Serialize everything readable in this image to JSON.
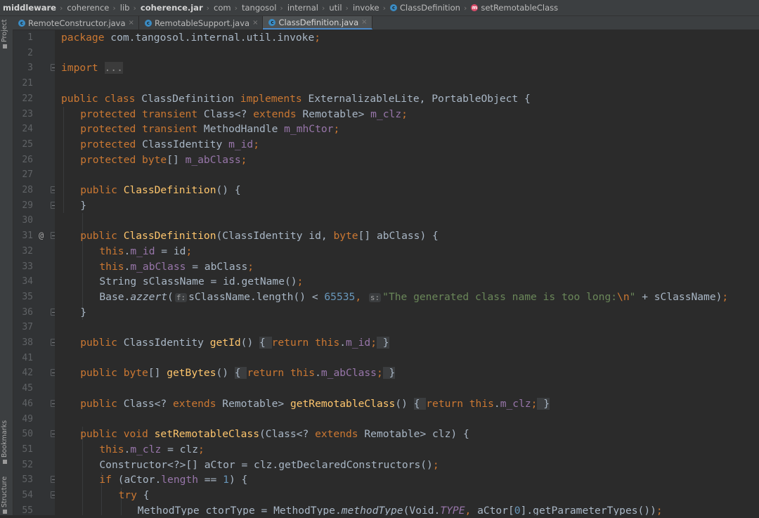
{
  "breadcrumbs": [
    {
      "label": "middleware",
      "bold": true,
      "icon": "none"
    },
    {
      "label": "coherence",
      "bold": false,
      "icon": "none"
    },
    {
      "label": "lib",
      "bold": false,
      "icon": "none"
    },
    {
      "label": "coherence.jar",
      "bold": true,
      "icon": "none"
    },
    {
      "label": "com",
      "bold": false,
      "icon": "none"
    },
    {
      "label": "tangosol",
      "bold": false,
      "icon": "none"
    },
    {
      "label": "internal",
      "bold": false,
      "icon": "none"
    },
    {
      "label": "util",
      "bold": false,
      "icon": "none"
    },
    {
      "label": "invoke",
      "bold": false,
      "icon": "none"
    },
    {
      "label": "ClassDefinition",
      "bold": false,
      "icon": "class-icon"
    },
    {
      "label": "setRemotableClass",
      "bold": false,
      "icon": "method-icon"
    }
  ],
  "tabs": [
    {
      "label": "RemoteConstructor.java",
      "active": false,
      "close": "×"
    },
    {
      "label": "RemotableSupport.java",
      "active": false,
      "close": "×"
    },
    {
      "label": "ClassDefinition.java",
      "active": true,
      "close": "×"
    }
  ],
  "sidebar": {
    "project_label": "Project",
    "bookmarks_label": "Bookmarks",
    "structure_label": "Structure"
  },
  "icon_glyphs": {
    "class-icon": "c",
    "method-icon": "m"
  },
  "colors": {
    "background": "#2b2b2b",
    "keyword": "#cc7832",
    "method": "#ffc66d",
    "field": "#9876aa",
    "string": "#6a8759",
    "number": "#6897bb",
    "text": "#a9b7c6"
  },
  "code": [
    {
      "n": "1",
      "fold": false,
      "mark": "",
      "indent": 0,
      "tokens": [
        [
          "kw",
          "package"
        ],
        [
          "t",
          " com.tangosol.internal.util.invoke"
        ],
        [
          "kw",
          ";"
        ]
      ]
    },
    {
      "n": "2",
      "fold": false,
      "mark": "",
      "indent": 0,
      "tokens": []
    },
    {
      "n": "3",
      "fold": true,
      "mark": "",
      "indent": 0,
      "tokens": [
        [
          "kw",
          "import"
        ],
        [
          "t",
          " "
        ],
        [
          "fold",
          "..."
        ]
      ]
    },
    {
      "n": "21",
      "fold": false,
      "mark": "",
      "indent": 0,
      "tokens": []
    },
    {
      "n": "22",
      "fold": false,
      "mark": "",
      "indent": 0,
      "tokens": [
        [
          "kw",
          "public class "
        ],
        [
          "t",
          "ClassDefinition "
        ],
        [
          "kw",
          "implements "
        ],
        [
          "t",
          "ExternalizableLite, PortableObject {"
        ]
      ]
    },
    {
      "n": "23",
      "fold": false,
      "mark": "",
      "indent": 1,
      "tokens": [
        [
          "kw",
          "protected transient "
        ],
        [
          "t",
          "Class<? "
        ],
        [
          "kw",
          "extends "
        ],
        [
          "t",
          "Remotable> "
        ],
        [
          "fld",
          "m_clz"
        ],
        [
          "kw",
          ";"
        ]
      ]
    },
    {
      "n": "24",
      "fold": false,
      "mark": "",
      "indent": 1,
      "tokens": [
        [
          "kw",
          "protected transient "
        ],
        [
          "t",
          "MethodHandle "
        ],
        [
          "fld",
          "m_mhCtor"
        ],
        [
          "kw",
          ";"
        ]
      ]
    },
    {
      "n": "25",
      "fold": false,
      "mark": "",
      "indent": 1,
      "tokens": [
        [
          "kw",
          "protected "
        ],
        [
          "t",
          "ClassIdentity "
        ],
        [
          "fld",
          "m_id"
        ],
        [
          "kw",
          ";"
        ]
      ]
    },
    {
      "n": "26",
      "fold": false,
      "mark": "",
      "indent": 1,
      "tokens": [
        [
          "kw",
          "protected byte"
        ],
        [
          "t",
          "[] "
        ],
        [
          "fld",
          "m_abClass"
        ],
        [
          "kw",
          ";"
        ]
      ]
    },
    {
      "n": "27",
      "fold": false,
      "mark": "",
      "indent": 0,
      "tokens": []
    },
    {
      "n": "28",
      "fold": true,
      "mark": "",
      "indent": 1,
      "tokens": [
        [
          "kw",
          "public "
        ],
        [
          "fn",
          "ClassDefinition"
        ],
        [
          "t",
          "() {"
        ]
      ]
    },
    {
      "n": "29",
      "fold": true,
      "mark": "",
      "indent": 1,
      "tokens": [
        [
          "t",
          "}"
        ]
      ]
    },
    {
      "n": "30",
      "fold": false,
      "mark": "",
      "indent": 0,
      "tokens": []
    },
    {
      "n": "31",
      "fold": true,
      "mark": "@",
      "indent": 1,
      "tokens": [
        [
          "kw",
          "public "
        ],
        [
          "fn",
          "ClassDefinition"
        ],
        [
          "t",
          "(ClassIdentity id, "
        ],
        [
          "kw",
          "byte"
        ],
        [
          "t",
          "[] abClass) {"
        ]
      ]
    },
    {
      "n": "32",
      "fold": false,
      "mark": "",
      "indent": 2,
      "tokens": [
        [
          "kw",
          "this"
        ],
        [
          "t",
          "."
        ],
        [
          "fld",
          "m_id"
        ],
        [
          "t",
          " = id"
        ],
        [
          "kw",
          ";"
        ]
      ]
    },
    {
      "n": "33",
      "fold": false,
      "mark": "",
      "indent": 2,
      "tokens": [
        [
          "kw",
          "this"
        ],
        [
          "t",
          "."
        ],
        [
          "fld",
          "m_abClass"
        ],
        [
          "t",
          " = abClass"
        ],
        [
          "kw",
          ";"
        ]
      ]
    },
    {
      "n": "34",
      "fold": false,
      "mark": "",
      "indent": 2,
      "tokens": [
        [
          "t",
          "String sClassName = id.getName()"
        ],
        [
          "kw",
          ";"
        ]
      ]
    },
    {
      "n": "35",
      "fold": false,
      "mark": "",
      "indent": 2,
      "tokens": [
        [
          "t",
          "Base."
        ],
        [
          "it",
          "azzert"
        ],
        [
          "t",
          "("
        ],
        [
          "hint",
          "f:"
        ],
        [
          "t",
          "sClassName.length() < "
        ],
        [
          "num",
          "65535"
        ],
        [
          "kw",
          ", "
        ],
        [
          "hint",
          "s:"
        ],
        [
          "str",
          "\"The generated class name is too long:"
        ],
        [
          "kw",
          "\\n"
        ],
        [
          "str",
          "\""
        ],
        [
          "t",
          " + sClassName)"
        ],
        [
          "kw",
          ";"
        ]
      ]
    },
    {
      "n": "36",
      "fold": true,
      "mark": "",
      "indent": 1,
      "tokens": [
        [
          "t",
          "}"
        ]
      ]
    },
    {
      "n": "37",
      "fold": false,
      "mark": "",
      "indent": 0,
      "tokens": []
    },
    {
      "n": "38",
      "fold": true,
      "mark": "",
      "indent": 1,
      "tokens": [
        [
          "kw",
          "public "
        ],
        [
          "t",
          "ClassIdentity "
        ],
        [
          "fn",
          "getId"
        ],
        [
          "t",
          "() "
        ],
        [
          "br",
          "{ "
        ],
        [
          "kw",
          "return this"
        ],
        [
          "t",
          "."
        ],
        [
          "fld",
          "m_id"
        ],
        [
          "kw",
          ";"
        ],
        [
          "br",
          " }"
        ]
      ]
    },
    {
      "n": "41",
      "fold": false,
      "mark": "",
      "indent": 0,
      "tokens": []
    },
    {
      "n": "42",
      "fold": true,
      "mark": "",
      "indent": 1,
      "tokens": [
        [
          "kw",
          "public byte"
        ],
        [
          "t",
          "[] "
        ],
        [
          "fn",
          "getBytes"
        ],
        [
          "t",
          "() "
        ],
        [
          "br",
          "{ "
        ],
        [
          "kw",
          "return this"
        ],
        [
          "t",
          "."
        ],
        [
          "fld",
          "m_abClass"
        ],
        [
          "kw",
          ";"
        ],
        [
          "br",
          " }"
        ]
      ]
    },
    {
      "n": "45",
      "fold": false,
      "mark": "",
      "indent": 0,
      "tokens": []
    },
    {
      "n": "46",
      "fold": true,
      "mark": "",
      "indent": 1,
      "tokens": [
        [
          "kw",
          "public "
        ],
        [
          "t",
          "Class<? "
        ],
        [
          "kw",
          "extends "
        ],
        [
          "t",
          "Remotable> "
        ],
        [
          "fn",
          "getRemotableClass"
        ],
        [
          "t",
          "() "
        ],
        [
          "br",
          "{ "
        ],
        [
          "kw",
          "return this"
        ],
        [
          "t",
          "."
        ],
        [
          "fld",
          "m_clz"
        ],
        [
          "kw",
          ";"
        ],
        [
          "br",
          " }"
        ]
      ]
    },
    {
      "n": "49",
      "fold": false,
      "mark": "",
      "indent": 0,
      "tokens": []
    },
    {
      "n": "50",
      "fold": true,
      "mark": "",
      "indent": 1,
      "tokens": [
        [
          "kw",
          "public void "
        ],
        [
          "fn",
          "setRemotableClass"
        ],
        [
          "t",
          "(Class<? "
        ],
        [
          "kw",
          "extends "
        ],
        [
          "t",
          "Remotable> clz) {"
        ]
      ]
    },
    {
      "n": "51",
      "fold": false,
      "mark": "",
      "indent": 2,
      "tokens": [
        [
          "kw",
          "this"
        ],
        [
          "t",
          "."
        ],
        [
          "fld",
          "m_clz"
        ],
        [
          "t",
          " = clz"
        ],
        [
          "kw",
          ";"
        ]
      ]
    },
    {
      "n": "52",
      "fold": false,
      "mark": "",
      "indent": 2,
      "tokens": [
        [
          "t",
          "Constructor<?>[] aCtor = clz.getDeclaredConstructors()"
        ],
        [
          "kw",
          ";"
        ]
      ]
    },
    {
      "n": "53",
      "fold": true,
      "mark": "",
      "indent": 2,
      "tokens": [
        [
          "kw",
          "if "
        ],
        [
          "t",
          "(aCtor."
        ],
        [
          "fld",
          "length"
        ],
        [
          "t",
          " == "
        ],
        [
          "num",
          "1"
        ],
        [
          "t",
          ") {"
        ]
      ]
    },
    {
      "n": "54",
      "fold": true,
      "mark": "",
      "indent": 3,
      "tokens": [
        [
          "kw",
          "try "
        ],
        [
          "t",
          "{"
        ]
      ]
    },
    {
      "n": "55",
      "fold": false,
      "mark": "",
      "indent": 4,
      "tokens": [
        [
          "t",
          "MethodType ctorType = MethodType."
        ],
        [
          "it",
          "methodType"
        ],
        [
          "t",
          "(Void."
        ],
        [
          "itf",
          "TYPE"
        ],
        [
          "kw",
          ", "
        ],
        [
          "t",
          "aCtor["
        ],
        [
          "num",
          "0"
        ],
        [
          "t",
          "].getParameterTypes())"
        ],
        [
          "kw",
          ";"
        ]
      ]
    }
  ]
}
